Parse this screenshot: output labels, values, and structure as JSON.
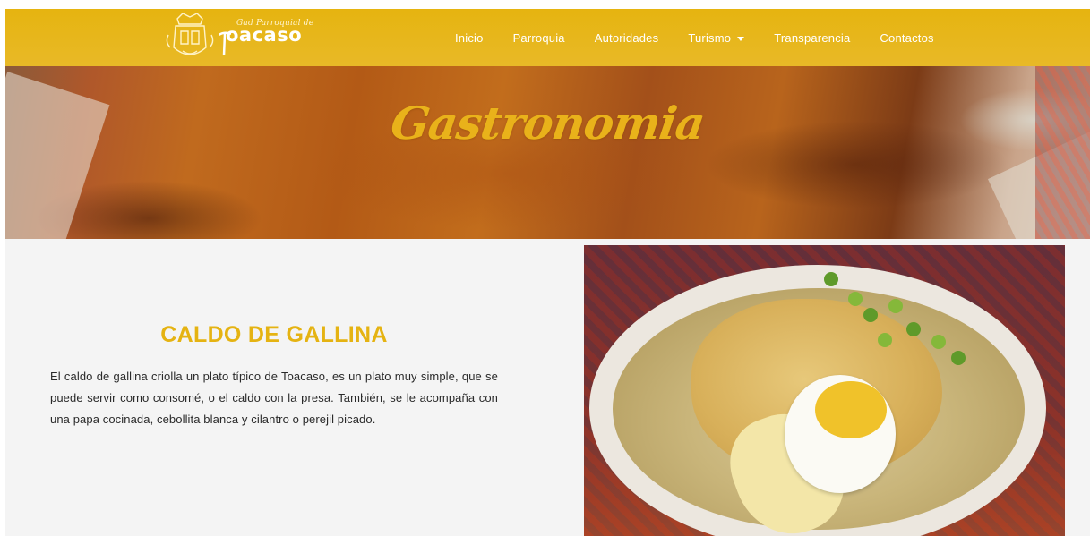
{
  "header": {
    "logo_small_text": "Gad Parroquial de",
    "logo_big_text": "oacaso",
    "nav_items": [
      {
        "label": "Inicio",
        "has_dropdown": false
      },
      {
        "label": "Parroquia",
        "has_dropdown": false
      },
      {
        "label": "Autoridades",
        "has_dropdown": false
      },
      {
        "label": "Turismo",
        "has_dropdown": true
      },
      {
        "label": "Transparencia",
        "has_dropdown": false
      },
      {
        "label": "Contactos",
        "has_dropdown": false
      }
    ]
  },
  "banner": {
    "title": "Gastronomia"
  },
  "dish": {
    "title": "CALDO DE GALLINA",
    "description": "El caldo de gallina criolla un plato típico de Toacaso, es un plato muy simple, que se puede servir como consomé, o el caldo con la presa. También, se le acompaña con una papa cocinada, cebollita blanca y cilantro o perejil picado."
  },
  "colors": {
    "brand_yellow": "#e6b410",
    "heading_yellow": "#e5b312",
    "body_text": "#2a2a2a",
    "background": "#f4f4f4"
  },
  "icons": {
    "logo": "parish-emblem-icon",
    "dropdown": "caret-down-icon"
  }
}
